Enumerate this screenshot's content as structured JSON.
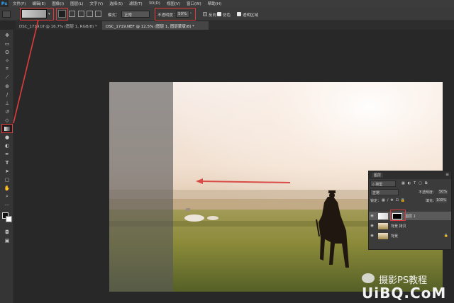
{
  "app": {
    "logo": "Ps"
  },
  "menu": [
    "文件(F)",
    "编辑(E)",
    "图像(I)",
    "图层(L)",
    "文字(Y)",
    "选择(S)",
    "滤镜(T)",
    "3D(D)",
    "视图(V)",
    "窗口(W)",
    "帮助(H)"
  ],
  "options": {
    "mode_label": "模式：",
    "mode_value": "正常",
    "opacity_label": "不透明度：",
    "opacity_value": "50%",
    "reverse_label": "反向",
    "dither_label": "仿色",
    "transparency_label": "透明区域"
  },
  "tabs": [
    {
      "label": "DSC_1719.tif @ 16.7% (图层 1, RGB/8) *"
    },
    {
      "label": "DSC_1719.NEF @ 12.5% (图层 1, 图层蒙版/8) *"
    }
  ],
  "tools": [
    "move-icon",
    "marquee-icon",
    "lasso-icon",
    "magic-wand-icon",
    "crop-icon",
    "eyedropper-icon",
    "healing-icon",
    "brush-icon",
    "stamp-icon",
    "history-brush-icon",
    "eraser-icon",
    "gradient-icon",
    "blur-icon",
    "dodge-icon",
    "pen-icon",
    "type-icon",
    "path-select-icon",
    "shape-icon",
    "hand-icon",
    "zoom-icon"
  ],
  "colors": {
    "accent": "#e03d3d",
    "ps_blue": "#31a8ff"
  },
  "layers_panel": {
    "title": "图层",
    "kind_label": "类型",
    "blend_mode": "正常",
    "opacity_label": "不透明度：",
    "opacity_value": "50%",
    "lock_label": "锁定：",
    "fill_label": "填充：",
    "fill_value": "100%",
    "layers": [
      {
        "name": "图层 1"
      },
      {
        "name": "背景 拷贝"
      },
      {
        "name": "背景"
      }
    ]
  },
  "watermark": {
    "brand": "摄影PS教程",
    "site": "UiBQ.CoM"
  }
}
